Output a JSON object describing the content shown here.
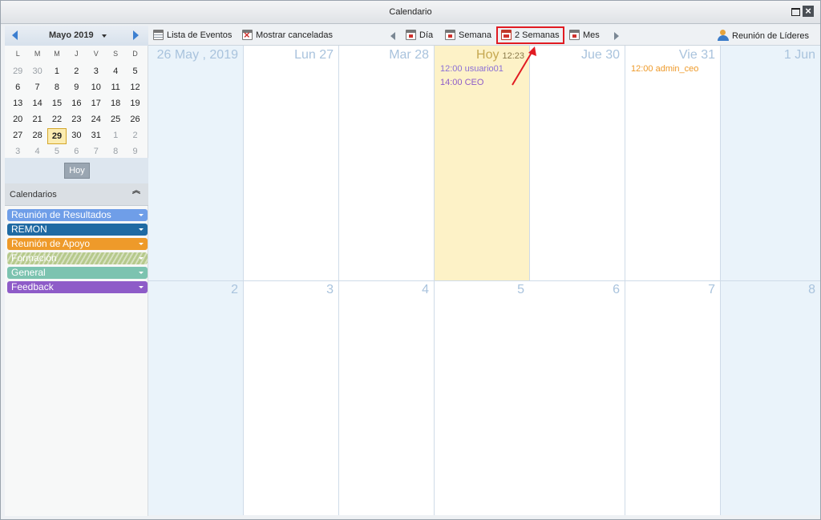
{
  "window": {
    "title": "Calendario"
  },
  "mini_calendar": {
    "month_label": "Mayo 2019",
    "weekdays": [
      "L",
      "M",
      "M",
      "J",
      "V",
      "S",
      "D"
    ],
    "weeks": [
      [
        "29",
        "30",
        "1",
        "2",
        "3",
        "4",
        "5"
      ],
      [
        "6",
        "7",
        "8",
        "9",
        "10",
        "11",
        "12"
      ],
      [
        "13",
        "14",
        "15",
        "16",
        "17",
        "18",
        "19"
      ],
      [
        "20",
        "21",
        "22",
        "23",
        "24",
        "25",
        "26"
      ],
      [
        "27",
        "28",
        "29",
        "30",
        "31",
        "1",
        "2"
      ],
      [
        "3",
        "4",
        "5",
        "6",
        "7",
        "8",
        "9"
      ]
    ],
    "today_button": "Hoy"
  },
  "calendars_panel": {
    "title": "Calendarios",
    "items": [
      {
        "label": "Reunión de Resultados",
        "color": "#6f9ee8"
      },
      {
        "label": "REMON",
        "color": "#1f6aa3"
      },
      {
        "label": "Reunión de Apoyo",
        "color": "#ee9a2a"
      },
      {
        "label": "Formación",
        "color": "#b6c98c"
      },
      {
        "label": "General",
        "color": "#7cc3b0"
      },
      {
        "label": "Feedback",
        "color": "#8e5cc8"
      }
    ]
  },
  "toolbar": {
    "event_list": "Lista de Eventos",
    "show_cancelled": "Mostrar canceladas",
    "day": "Día",
    "week": "Semana",
    "two_weeks": "2 Semanas",
    "month": "Mes",
    "calendar_selector": "Reunión de Líderes"
  },
  "grid": {
    "week1": [
      "26 May , 2019",
      "Lun 27",
      "Mar 28",
      "Hoy",
      "Jue 30",
      "Vie 31",
      "1 Jun"
    ],
    "today_time": "12:23",
    "week2": [
      "2",
      "3",
      "4",
      "5",
      "6",
      "7",
      "8"
    ],
    "events": {
      "wed": [
        {
          "text": "12:00 usuario01",
          "color": "#8b6fd6"
        },
        {
          "text": "14:00 CEO",
          "color": "#8e5cc8"
        }
      ],
      "fri": [
        {
          "text": "12:00 admin_ceo",
          "color": "#ee9a2a"
        }
      ]
    }
  },
  "colors": {
    "accent_blue": "#3c7fd0",
    "today_bg": "#fdf2c7",
    "weekend_bg": "#eaf3fa",
    "highlight_red": "#e11b22"
  }
}
